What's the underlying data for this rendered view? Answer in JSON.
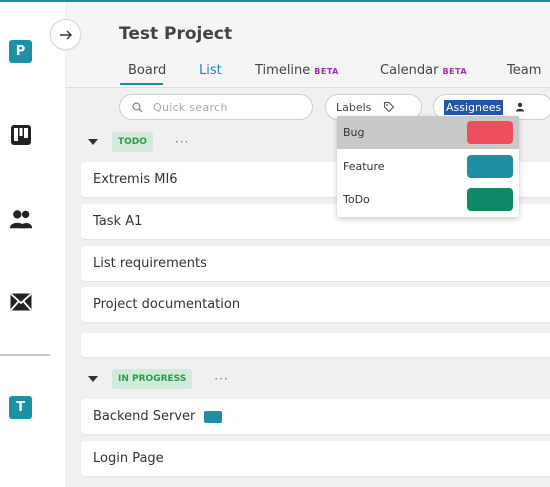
{
  "app": {
    "project_badge": "P",
    "team_badge": "T",
    "icons": [
      "boards-icon",
      "team-icon",
      "mail-icon",
      "collapse-arrow-icon"
    ]
  },
  "header": {
    "title": "Test Project",
    "tabs": [
      {
        "label": "Board",
        "beta": ""
      },
      {
        "label": "List",
        "beta": "",
        "active": true
      },
      {
        "label": "Timeline",
        "beta": "BETA"
      },
      {
        "label": "Calendar",
        "beta": "BETA"
      },
      {
        "label": "Team",
        "beta": ""
      }
    ]
  },
  "filters": {
    "search_placeholder": "Quick search",
    "labels_button": "Labels",
    "assignees_button": "Assignees"
  },
  "sections": [
    {
      "status": "TODO",
      "more": "···",
      "cards": [
        "Extremis MI6",
        "Task A1",
        "List requirements",
        "Project documentation",
        ""
      ]
    },
    {
      "status": "IN PROGRESS",
      "more": "···",
      "cards": [
        "Backend Server",
        "Login Page"
      ]
    }
  ],
  "labels_dropdown": {
    "items": [
      {
        "name": "Bug",
        "color": "#ef4f5b"
      },
      {
        "name": "Feature",
        "color": "#1e8fa5"
      },
      {
        "name": "ToDo",
        "color": "#0f8a68"
      }
    ],
    "hovered": "Bug"
  },
  "colors": {
    "accent": "#1b8ea3",
    "beta": "#9b2fae",
    "status_pill_bg": "#d2eadb",
    "status_pill_text": "#2a9a4a"
  }
}
